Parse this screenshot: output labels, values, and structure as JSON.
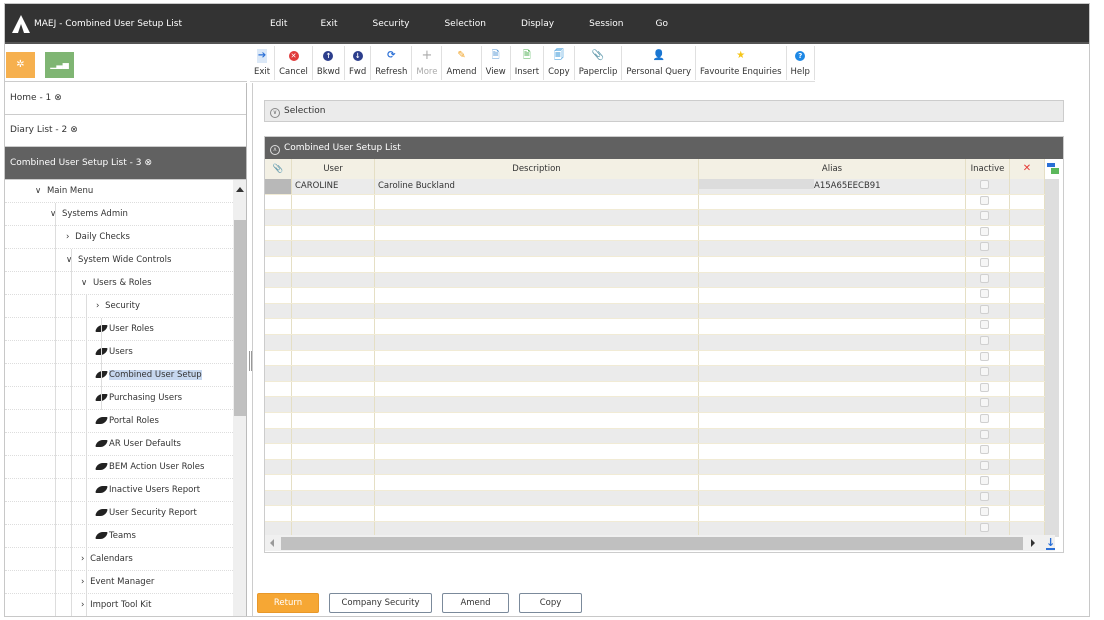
{
  "window": {
    "title": "MAEJ - Combined User Setup List"
  },
  "menu": [
    "Edit",
    "Exit",
    "Security",
    "Selection",
    "Display",
    "Session",
    "Go"
  ],
  "quickbar": {
    "settings_icon": "gear-icon",
    "stats_icon": "signal-bars-icon",
    "settings_color": "#f6b04e",
    "stats_color": "#7fb573"
  },
  "toolbar": [
    {
      "label": "Exit",
      "icon": "exit-arrow-icon",
      "enabled": true
    },
    {
      "label": "Cancel",
      "icon": "cancel-icon",
      "enabled": true
    },
    {
      "label": "Bkwd",
      "icon": "up-arrow-icon",
      "enabled": true
    },
    {
      "label": "Fwd",
      "icon": "down-arrow-icon",
      "enabled": true
    },
    {
      "label": "Refresh",
      "icon": "refresh-icon",
      "enabled": true
    },
    {
      "label": "More",
      "icon": "plus-icon",
      "enabled": false
    },
    {
      "label": "Amend",
      "icon": "pencil-icon",
      "enabled": true
    },
    {
      "label": "View",
      "icon": "view-doc-icon",
      "enabled": true
    },
    {
      "label": "Insert",
      "icon": "insert-doc-icon",
      "enabled": true
    },
    {
      "label": "Copy",
      "icon": "copy-doc-icon",
      "enabled": true
    },
    {
      "label": "Paperclip",
      "icon": "paperclip-icon",
      "enabled": true
    },
    {
      "label": "Personal Query",
      "icon": "user-search-icon",
      "enabled": true
    },
    {
      "label": "Favourite Enquiries",
      "icon": "star-icon",
      "enabled": true
    },
    {
      "label": "Help",
      "icon": "help-icon",
      "enabled": true
    }
  ],
  "tabs": [
    {
      "label": "Home - 1",
      "active": false
    },
    {
      "label": "Diary List - 2",
      "active": false
    },
    {
      "label": "Combined User Setup List - 3",
      "active": true
    }
  ],
  "tree": [
    {
      "label": "Main Menu",
      "type": "expanded",
      "level": 0
    },
    {
      "label": "Systems Admin",
      "type": "expanded",
      "level": 1
    },
    {
      "label": "Daily Checks",
      "type": "collapsed",
      "level": 2
    },
    {
      "label": "System Wide Controls",
      "type": "expanded",
      "level": 2
    },
    {
      "label": "Users & Roles",
      "type": "expanded",
      "level": 3
    },
    {
      "label": "Security",
      "type": "collapsed",
      "level": 4
    },
    {
      "label": "User Roles",
      "type": "leaf",
      "level": 4
    },
    {
      "label": "Users",
      "type": "leaf",
      "level": 4
    },
    {
      "label": "Combined User Setup",
      "type": "leaf",
      "level": 4,
      "selected": true
    },
    {
      "label": "Purchasing Users",
      "type": "leaf",
      "level": 4
    },
    {
      "label": "Portal Roles",
      "type": "leaf",
      "level": 4
    },
    {
      "label": "AR User Defaults",
      "type": "leaf",
      "level": 4
    },
    {
      "label": "BEM Action User Roles",
      "type": "leaf",
      "level": 4
    },
    {
      "label": "Inactive Users Report",
      "type": "leaf",
      "level": 4
    },
    {
      "label": "User Security Report",
      "type": "leaf",
      "level": 4
    },
    {
      "label": "Teams",
      "type": "leaf",
      "level": 4
    },
    {
      "label": "Calendars",
      "type": "collapsed",
      "level": 3
    },
    {
      "label": "Event Manager",
      "type": "collapsed",
      "level": 3
    },
    {
      "label": "Import Tool Kit",
      "type": "collapsed",
      "level": 3
    }
  ],
  "selection_panel": {
    "label": "Selection"
  },
  "grid": {
    "title": "Combined User Setup List",
    "columns": [
      "",
      "User",
      "Description",
      "Alias",
      "Inactive",
      ""
    ],
    "rows": [
      {
        "user": "CAROLINE",
        "description": "Caroline Buckland",
        "alias": "A15A65EECB91",
        "inactive": false
      }
    ],
    "empty_rows": 22
  },
  "actions": {
    "return": "Return",
    "company_security": "Company Security",
    "amend": "Amend",
    "copy": "Copy"
  }
}
